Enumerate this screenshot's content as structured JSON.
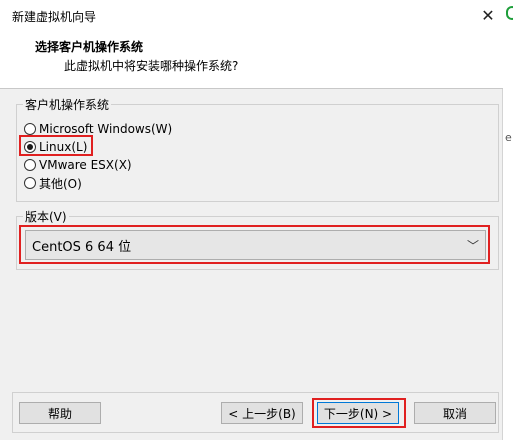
{
  "window": {
    "title": "新建虚拟机向导",
    "close_symbol": "✕"
  },
  "header": {
    "title": "选择客户机操作系统",
    "subtitle": "此虚拟机中将安装哪种操作系统?"
  },
  "os_group": {
    "legend": "客户机操作系统",
    "options": [
      {
        "label": "Microsoft Windows(W)",
        "selected": false
      },
      {
        "label": "Linux(L)",
        "selected": true
      },
      {
        "label": "VMware ESX(X)",
        "selected": false
      },
      {
        "label": "其他(O)",
        "selected": false
      }
    ]
  },
  "version_group": {
    "legend": "版本(V)",
    "selected": "CentOS 6 64 位",
    "chevron": "﹀"
  },
  "buttons": {
    "help": "帮助",
    "back": "< 上一步(B)",
    "next": "下一步(N) >",
    "cancel": "取消"
  },
  "highlight_color": "#e02020",
  "background_edge": {
    "letter": "e"
  }
}
